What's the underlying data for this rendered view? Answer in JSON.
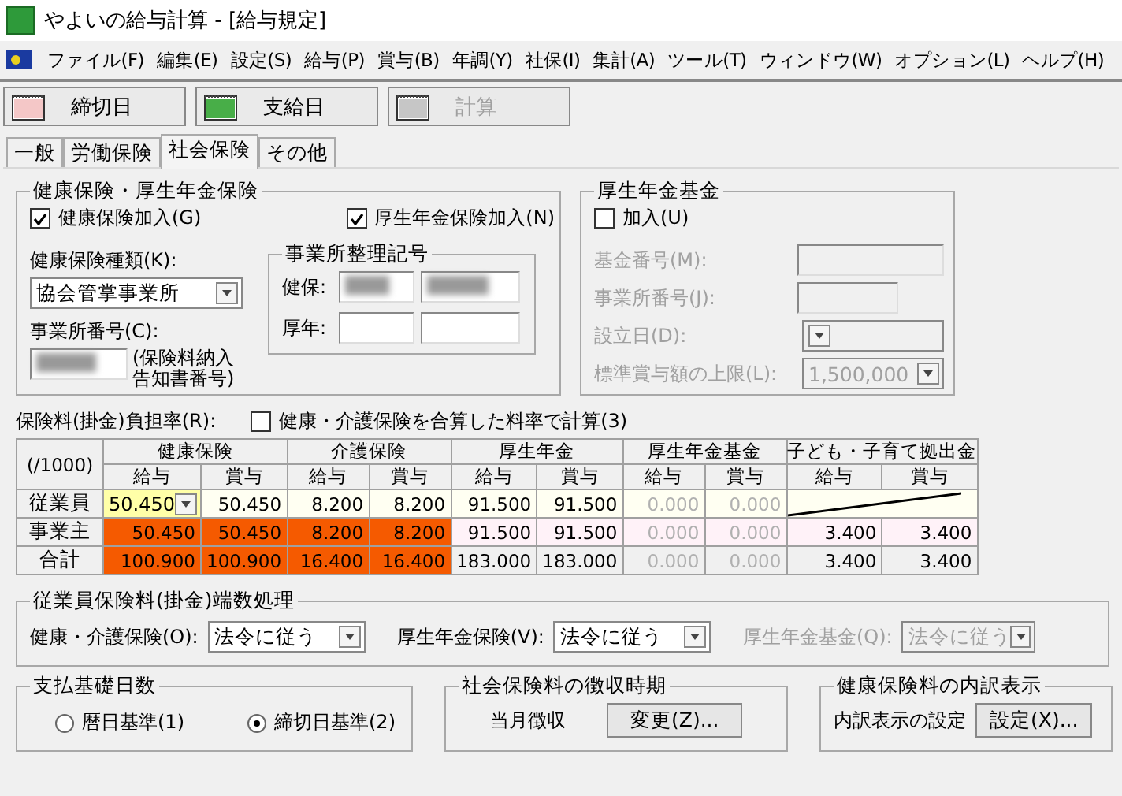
{
  "window": {
    "title": "やよいの給与計算 - [給与規定]"
  },
  "menu": [
    "ファイル(F)",
    "編集(E)",
    "設定(S)",
    "給与(P)",
    "賞与(B)",
    "年調(Y)",
    "社保(I)",
    "集計(A)",
    "ツール(T)",
    "ウィンドウ(W)",
    "オプション(L)",
    "ヘルプ(H)"
  ],
  "toolbar": [
    {
      "label": "締切日",
      "kind": "closing",
      "disabled": false
    },
    {
      "label": "支給日",
      "kind": "payday",
      "disabled": false
    },
    {
      "label": "計算",
      "kind": "calc",
      "disabled": true
    }
  ],
  "tabs": [
    {
      "label": "一般",
      "selected": false
    },
    {
      "label": "労働保険",
      "selected": false
    },
    {
      "label": "社会保険",
      "selected": true
    },
    {
      "label": "その他",
      "selected": false
    }
  ],
  "health_pension": {
    "title": "健康保険・厚生年金保険",
    "checkboxes": [
      {
        "label": "健康保険加入(G)",
        "checked": true
      },
      {
        "label": "厚生年金保険加入(N)",
        "checked": true
      }
    ],
    "insurance_type": {
      "label": "健康保険種類(K):",
      "value": "協会管掌事業所"
    },
    "office_number": {
      "label": "事業所番号(C):",
      "redacted": true,
      "note": "(保険料納入告知書番号)"
    },
    "reference": {
      "title": "事業所整理記号",
      "rows": [
        {
          "label": "健保:",
          "fields": [
            {
              "redacted": true
            },
            {
              "redacted": true
            }
          ]
        },
        {
          "label": "厚年:",
          "fields": [
            {
              "redacted": false
            },
            {
              "redacted": false
            }
          ]
        }
      ]
    }
  },
  "pension_fund": {
    "title": "厚生年金基金",
    "checkbox": {
      "label": "加入(U)",
      "checked": false
    },
    "fields": [
      {
        "label": "基金番号(M):",
        "kind": "wide_text",
        "disabled": true
      },
      {
        "label": "事業所番号(J):",
        "kind": "short_text",
        "disabled": true
      },
      {
        "label": "設立日(D):",
        "kind": "select",
        "disabled": true
      },
      {
        "label": "標準賞与額の上限(L):",
        "kind": "select",
        "value": "1,500,000",
        "disabled": true
      }
    ]
  },
  "rates": {
    "label": "保険料(掛金)負担率(R):",
    "combined": {
      "label": "健康・介護保険を合算した料率で計算(3)",
      "checked": false
    }
  },
  "table": {
    "corner": "(/1000)",
    "groups": [
      {
        "label": "健康保険",
        "subs": [
          "給与",
          "賞与"
        ]
      },
      {
        "label": "介護保険",
        "subs": [
          "給与",
          "賞与"
        ]
      },
      {
        "label": "厚生年金",
        "subs": [
          "給与",
          "賞与"
        ]
      },
      {
        "label": "厚生年金基金",
        "subs": [
          "給与",
          "賞与"
        ]
      },
      {
        "label": "子ども・子育て拠出金",
        "subs": [
          "給与",
          "賞与"
        ]
      }
    ],
    "rows": [
      {
        "label": "従業員",
        "kind": "employee",
        "cells": [
          {
            "kind": "edit",
            "value": "50.450"
          },
          {
            "kind": "value",
            "value": "50.450",
            "disabled": false,
            "highlighted": false
          },
          {
            "kind": "value",
            "value": "8.200",
            "disabled": false,
            "highlighted": false
          },
          {
            "kind": "value",
            "value": "8.200",
            "disabled": false,
            "highlighted": false
          },
          {
            "kind": "value",
            "value": "91.500",
            "disabled": false,
            "highlighted": false
          },
          {
            "kind": "value",
            "value": "91.500",
            "disabled": false,
            "highlighted": false
          },
          {
            "kind": "value",
            "value": "0.000",
            "disabled": true,
            "highlighted": false
          },
          {
            "kind": "value",
            "value": "0.000",
            "disabled": true,
            "highlighted": false
          },
          {
            "kind": "slash"
          }
        ]
      },
      {
        "label": "事業主",
        "kind": "employer",
        "cells": [
          {
            "kind": "value",
            "value": "50.450",
            "disabled": false,
            "highlighted": true
          },
          {
            "kind": "value",
            "value": "50.450",
            "disabled": false,
            "highlighted": true
          },
          {
            "kind": "value",
            "value": "8.200",
            "disabled": false,
            "highlighted": true
          },
          {
            "kind": "value",
            "value": "8.200",
            "disabled": false,
            "highlighted": true
          },
          {
            "kind": "value",
            "value": "91.500",
            "disabled": false,
            "highlighted": false
          },
          {
            "kind": "value",
            "value": "91.500",
            "disabled": false,
            "highlighted": false
          },
          {
            "kind": "value",
            "value": "0.000",
            "disabled": true,
            "highlighted": false
          },
          {
            "kind": "value",
            "value": "0.000",
            "disabled": true,
            "highlighted": false
          },
          {
            "kind": "value",
            "value": "3.400",
            "disabled": false,
            "highlighted": false
          },
          {
            "kind": "value",
            "value": "3.400",
            "disabled": false,
            "highlighted": false
          }
        ]
      },
      {
        "label": "合計",
        "kind": "total",
        "cells": [
          {
            "kind": "value",
            "value": "100.900",
            "disabled": false,
            "highlighted": true
          },
          {
            "kind": "value",
            "value": "100.900",
            "disabled": false,
            "highlighted": true
          },
          {
            "kind": "value",
            "value": "16.400",
            "disabled": false,
            "highlighted": true
          },
          {
            "kind": "value",
            "value": "16.400",
            "disabled": false,
            "highlighted": true
          },
          {
            "kind": "value",
            "value": "183.000",
            "disabled": false,
            "highlighted": false
          },
          {
            "kind": "value",
            "value": "183.000",
            "disabled": false,
            "highlighted": false
          },
          {
            "kind": "value",
            "value": "0.000",
            "disabled": true,
            "highlighted": false
          },
          {
            "kind": "value",
            "value": "0.000",
            "disabled": true,
            "highlighted": false
          },
          {
            "kind": "value",
            "value": "3.400",
            "disabled": false,
            "highlighted": false
          },
          {
            "kind": "value",
            "value": "3.400",
            "disabled": false,
            "highlighted": false
          }
        ]
      }
    ]
  },
  "rounding": {
    "title": "従業員保険料(掛金)端数処理",
    "items": [
      {
        "label": "健康・介護保険(O):",
        "value": "法令に従う",
        "disabled": false
      },
      {
        "label": "厚生年金保険(V):",
        "value": "法令に従う",
        "disabled": false
      },
      {
        "label": "厚生年金基金(Q):",
        "value": "法令に従う",
        "disabled": true
      }
    ]
  },
  "basis_days": {
    "title": "支払基礎日数",
    "options": [
      {
        "label": "暦日基準(1)",
        "selected": false
      },
      {
        "label": "締切日基準(2)",
        "selected": true
      }
    ]
  },
  "collection": {
    "title": "社会保険料の徴収時期",
    "value": "当月徴収",
    "button": "変更(Z)..."
  },
  "breakdown": {
    "title": "健康保険料の内訳表示",
    "label": "内訳表示の設定",
    "button": "設定(X)..."
  }
}
